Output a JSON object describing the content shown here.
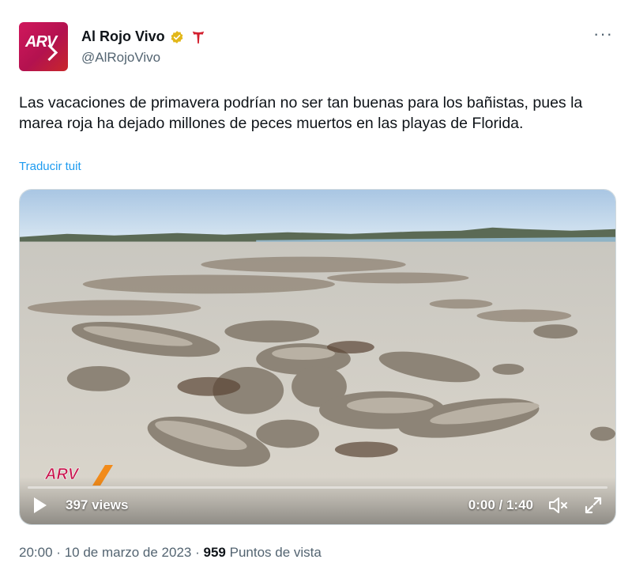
{
  "author": {
    "display_name": "Al Rojo Vivo",
    "handle": "@AlRojoVivo",
    "avatar_text": "ARV",
    "verified_badge": "gold-verified-badge-icon",
    "affiliate_icon": "telemundo-t-icon"
  },
  "tweet": {
    "text": "Las vacaciones de primavera podrían no ser tan buenas para los bañistas, pues la marea roja ha dejado millones de peces muertos en las playas de Florida.",
    "translate_label": "Traducir tuit"
  },
  "video": {
    "views_label": "397 views",
    "time_label": "0:00 / 1:40",
    "watermark_text": "ARV"
  },
  "meta": {
    "time": "20:00",
    "separator": "·",
    "date": "10 de marzo de 2023",
    "views_count": "959",
    "views_label": "Puntos de vista"
  },
  "colors": {
    "accent": "#1d9bf0",
    "brand": "#c8174f",
    "secondary_text": "#536471"
  }
}
